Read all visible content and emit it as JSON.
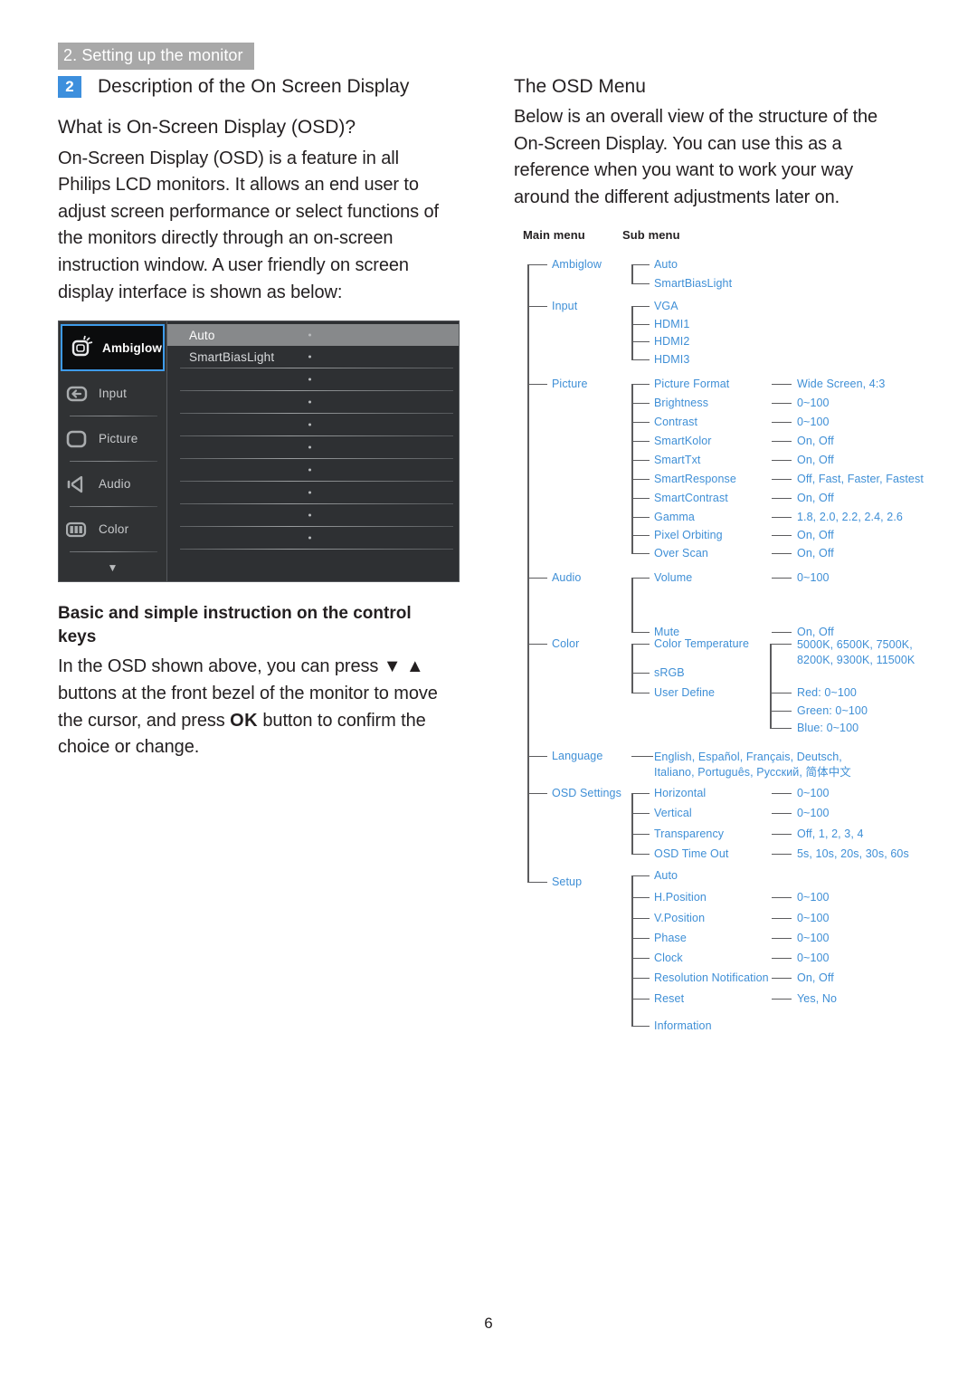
{
  "running_head": "2. Setting up the monitor",
  "page_number": "6",
  "colors": {
    "accent_blue": "#3d8fdd",
    "tree_blue": "#3f8fd6",
    "header_gray": "#a8a8a8",
    "line_gray": "#5c5c5e"
  },
  "left": {
    "section_number": "2",
    "section_title": "Description of the On Screen Display",
    "heading_what": "What is On-Screen Display (OSD)?",
    "body_what": "On-Screen Display (OSD) is a feature in all Philips LCD monitors. It allows an end user to adjust screen performance or select functions of the monitors directly through an on-screen instruction window. A user friendly on screen display interface is shown as below:",
    "heading_keys": "Basic and simple instruction on the control keys",
    "body_keys_1": "In the OSD shown above, you can press ",
    "body_keys_down": "▼",
    "body_keys_up": "▲",
    "body_keys_2": " buttons at the front bezel of the monitor to move the cursor, and press ",
    "body_keys_ok": "OK",
    "body_keys_3": " button to confirm the choice or change."
  },
  "right": {
    "heading_osd_menu": "The OSD Menu",
    "body_osd_menu": "Below is an overall view of the structure of the On-Screen Display. You can use this as a reference when you want to work your way around the different adjustments later on."
  },
  "osd_screenshot": {
    "left_items": [
      {
        "label": "Ambiglow",
        "icon": "ambiglow-icon",
        "selected": true
      },
      {
        "label": "Input",
        "icon": "input-icon",
        "selected": false
      },
      {
        "label": "Picture",
        "icon": "picture-icon",
        "selected": false
      },
      {
        "label": "Audio",
        "icon": "audio-icon",
        "selected": false
      },
      {
        "label": "Color",
        "icon": "color-icon",
        "selected": false
      }
    ],
    "scroll_down_glyph": "▼",
    "right_rows": [
      {
        "label": "Auto",
        "highlighted": true
      },
      {
        "label": "SmartBiasLight",
        "highlighted": false
      },
      {
        "label": "",
        "highlighted": false
      },
      {
        "label": "",
        "highlighted": false
      },
      {
        "label": "",
        "highlighted": false
      },
      {
        "label": "",
        "highlighted": false
      },
      {
        "label": "",
        "highlighted": false
      },
      {
        "label": "",
        "highlighted": false
      },
      {
        "label": "",
        "highlighted": false
      },
      {
        "label": "",
        "highlighted": false
      }
    ]
  },
  "tree": {
    "header_main": "Main menu",
    "header_sub": "Sub menu",
    "main_items": [
      "Ambiglow",
      "Input",
      "Picture",
      "Audio",
      "Color",
      "Language",
      "OSD Settings",
      "Setup"
    ],
    "sub_items": [
      "Auto",
      "SmartBiasLight",
      "VGA",
      "HDMI1",
      "HDMI2",
      "HDMI3",
      "Picture Format",
      "Brightness",
      "Contrast",
      "SmartKolor",
      "SmartTxt",
      "SmartResponse",
      "SmartContrast",
      "Gamma",
      "Pixel Orbiting",
      "Over Scan",
      "Volume",
      "Mute",
      "Color Temperature",
      "sRGB",
      "User Define",
      "English, Español, Français, Deutsch, Italiano, Português, Русский, 简体中文",
      "Horizontal",
      "Vertical",
      "Transparency",
      "OSD Time Out",
      "Auto",
      "H.Position",
      "V.Position",
      "Phase",
      "Clock",
      "Resolution Notification",
      "Reset",
      "Information"
    ],
    "values": [
      "Wide Screen, 4:3",
      "0~100",
      "0~100",
      "On, Off",
      "On, Off",
      "Off, Fast, Faster, Fastest",
      "On, Off",
      "1.8, 2.0, 2.2, 2.4, 2.6",
      "On, Off",
      "On, Off",
      "0~100",
      "On, Off",
      "5000K, 6500K, 7500K, 8200K, 9300K, 11500K",
      "Red: 0~100",
      "Green: 0~100",
      "Blue: 0~100",
      "0~100",
      "0~100",
      "Off, 1, 2, 3, 4",
      "5s, 10s, 20s, 30s, 60s",
      "0~100",
      "0~100",
      "0~100",
      "0~100",
      "On, Off",
      "Yes, No"
    ],
    "nodes": {
      "ambiglow": "Ambiglow",
      "ambiglow_auto": "Auto",
      "ambiglow_sbl": "SmartBiasLight",
      "input": "Input",
      "input_vga": "VGA",
      "input_hdmi1": "HDMI1",
      "input_hdmi2": "HDMI2",
      "input_hdmi3": "HDMI3",
      "picture": "Picture",
      "pic_format": "Picture Format",
      "pic_format_v": "Wide Screen, 4:3",
      "pic_bright": "Brightness",
      "pic_bright_v": "0~100",
      "pic_contrast": "Contrast",
      "pic_contrast_v": "0~100",
      "pic_kolor": "SmartKolor",
      "pic_kolor_v": "On, Off",
      "pic_txt": "SmartTxt",
      "pic_txt_v": "On, Off",
      "pic_resp": "SmartResponse",
      "pic_resp_v": "Off, Fast, Faster, Fastest",
      "pic_scontrast": "SmartContrast",
      "pic_scontrast_v": "On, Off",
      "pic_gamma": "Gamma",
      "pic_gamma_v": "1.8, 2.0, 2.2, 2.4, 2.6",
      "pic_orbit": "Pixel Orbiting",
      "pic_orbit_v": "On, Off",
      "pic_overscan": "Over Scan",
      "pic_overscan_v": "On, Off",
      "audio": "Audio",
      "aud_volume": "Volume",
      "aud_volume_v": "0~100",
      "aud_mute": "Mute",
      "aud_mute_v": "On, Off",
      "color": "Color",
      "col_temp": "Color Temperature",
      "col_temp_v": "5000K, 6500K, 7500K, 8200K, 9300K, 11500K",
      "col_srgb": "sRGB",
      "col_user": "User Define",
      "col_red": "Red: 0~100",
      "col_green": "Green: 0~100",
      "col_blue": "Blue: 0~100",
      "language": "Language",
      "language_v": "English, Español, Français, Deutsch, Italiano, Português, Русский, 简体中文",
      "osd_settings": "OSD Settings",
      "osd_h": "Horizontal",
      "osd_h_v": "0~100",
      "osd_v": "Vertical",
      "osd_v_v": "0~100",
      "osd_trans": "Transparency",
      "osd_trans_v": "Off, 1, 2, 3, 4",
      "osd_timeout": "OSD Time Out",
      "osd_timeout_v": "5s, 10s, 20s, 30s, 60s",
      "setup": "Setup",
      "set_auto": "Auto",
      "set_hpos": "H.Position",
      "set_hpos_v": "0~100",
      "set_vpos": "V.Position",
      "set_vpos_v": "0~100",
      "set_phase": "Phase",
      "set_phase_v": "0~100",
      "set_clock": "Clock",
      "set_clock_v": "0~100",
      "set_resnotif": "Resolution Notification",
      "set_resnotif_v": "On, Off",
      "set_reset": "Reset",
      "set_reset_v": "Yes, No",
      "set_info": "Information"
    }
  }
}
